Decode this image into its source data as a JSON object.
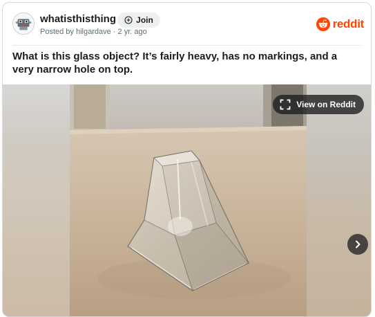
{
  "post": {
    "subreddit": "whatisthisthing",
    "join_label": "Join",
    "meta_posted_by": "Posted by hilgardave",
    "meta_separator": "·",
    "meta_age": "2 yr. ago",
    "title": "What is this glass object? It’s fairly heavy, has no markings, and a very narrow hole on top."
  },
  "brand": {
    "wordmark": "reddit",
    "accent_color": "#ff4500"
  },
  "media": {
    "view_on_reddit_label": "View on Reddit",
    "image_alt": "Clear pyramidal glass object sitting on a wooden table"
  },
  "icons": {
    "join": "plus-circle-icon",
    "expand": "expand-icon",
    "next": "chevron-right-icon",
    "logo": "reddit-snoo-icon",
    "avatar": "subreddit-avatar-icon"
  }
}
